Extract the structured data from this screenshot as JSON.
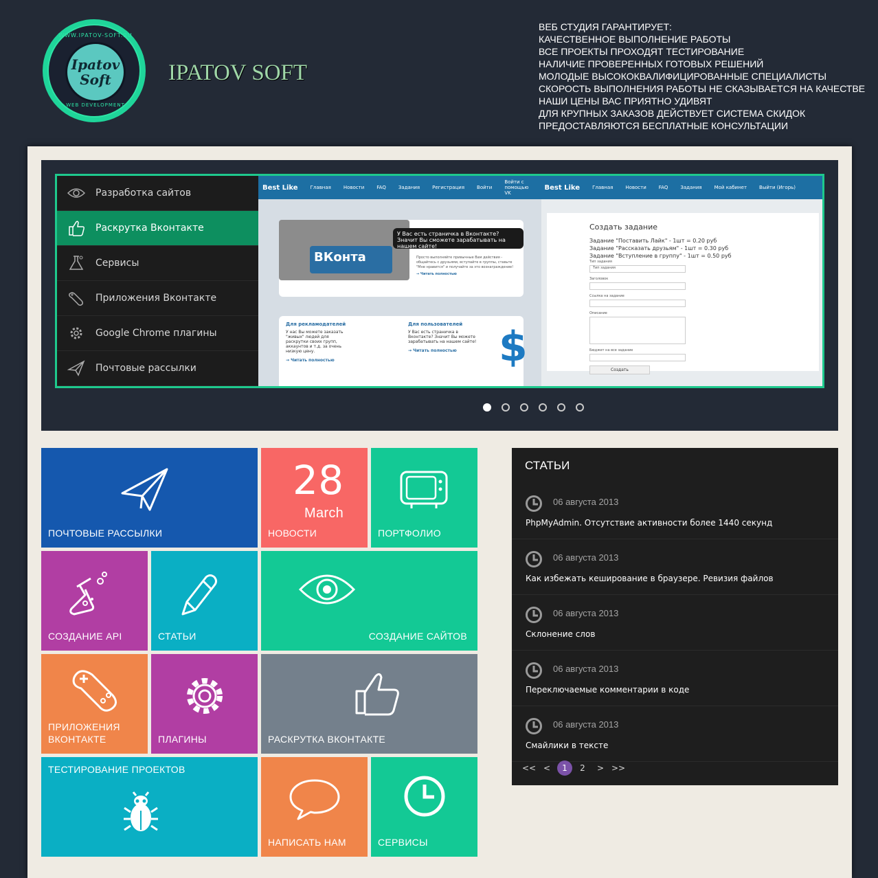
{
  "brand": {
    "name": "IPATOV SOFT",
    "logo_url_text": "WWW.IPATOV-SOFT.RU",
    "logo_name_line1": "Ipatov",
    "logo_name_line2": "Soft",
    "logo_bottom_text": "WEB DEVELOPMENT"
  },
  "guarantees": [
    "ВЕБ СТУДИЯ ГАРАНТИРУЕТ:",
    "КАЧЕСТВЕННОЕ ВЫПОЛНЕНИЕ РАБОТЫ",
    "ВСЕ ПРОЕКТЫ ПРОХОДЯТ ТЕСТИРОВАНИЕ",
    "НАЛИЧИЕ ПРОВЕРЕННЫХ ГОТОВЫХ РЕШЕНИЙ",
    "МОЛОДЫЕ ВЫСОКОКВАЛИФИЦИРОВАННЫЕ СПЕЦИАЛИСТЫ",
    "СКОРОСТЬ ВЫПОЛНЕНИЯ РАБОТЫ НЕ СКАЗЫВАЕТСЯ НА КАЧЕСТВЕ",
    "НАШИ ЦЕНЫ ВАС ПРИЯТНО УДИВЯТ",
    "ДЛЯ КРУПНЫХ ЗАКАЗОВ ДЕЙСТВУЕТ СИСТЕМА СКИДОК",
    "ПРЕДОСТАВЛЯЮТСЯ БЕСПЛАТНЫЕ КОНСУЛЬТАЦИИ"
  ],
  "slider": {
    "menu": [
      {
        "label": "Разработка сайтов",
        "icon": "eye-icon"
      },
      {
        "label": "Раскрутка Вконтакте",
        "icon": "thumbs-up-icon"
      },
      {
        "label": "Сервисы",
        "icon": "flask-icon"
      },
      {
        "label": "Приложения Вконтакте",
        "icon": "gamepad-icon"
      },
      {
        "label": "Google Chrome плагины",
        "icon": "gear-icon"
      },
      {
        "label": "Почтовые рассылки",
        "icon": "paper-plane-icon"
      }
    ],
    "active_index": 1,
    "slide": {
      "nav_left": [
        "Best Like",
        "Главная",
        "Новости",
        "FAQ",
        "Задания",
        "Регистрация",
        "Войти",
        "Войти с помощью VK"
      ],
      "nav_right": [
        "Best Like",
        "Главная",
        "Новости",
        "FAQ",
        "Задания",
        "Мой кабинет",
        "Выйти (Игорь)"
      ],
      "browser_text": "ВКонта",
      "bubble": "У Вас есть страничка в Вконтакте? Значит Вы сможете зарабатывать на нашем сайте!",
      "card_text": "Просто выполняйте привычные Вам действия - общайтесь с друзьями, вступайте в группы, ставьте \"Мне нравится\" и получайте за это вознаграждение!",
      "read_more": "→ Читать полностью",
      "adv_title": "Для рекламодателей",
      "adv_text": "У нас Вы можете заказать \"живых\" людей для раскрутки своих групп, аккаунтов и т.д. за очень низкую цену.",
      "user_title": "Для пользователей",
      "user_text": "У Вас есть страничка в Вконтакте? Значит Вы можете зарабатывать на нашем сайте!",
      "form_title": "Создать задание",
      "form_lines": [
        "Задание \"Поставить Лайк\" - 1шт = 0.20 руб",
        "Задание \"Рассказать друзьям\" - 1шт = 0.30 руб",
        "Задание \"Вступление в группу\" - 1шт = 0.50 руб"
      ],
      "form_labels": [
        "Тип задания",
        "Заголовок",
        "Ссылка на задание",
        "Описание",
        "Бюджет на все задание"
      ],
      "form_select": "Тип задания",
      "form_button": "Создать"
    },
    "dots_count": 6,
    "active_dot": 0
  },
  "tiles": {
    "mail": {
      "label": "ПОЧТОВЫЕ РАССЫЛКИ",
      "color": "#1558ae",
      "icon": "paper-plane-icon"
    },
    "news": {
      "label": "НОВОСТИ",
      "day": "28",
      "month": "March",
      "color": "#f86765"
    },
    "portfolio": {
      "label": "ПОРТФОЛИО",
      "color": "#13c995",
      "icon": "tv-icon"
    },
    "api": {
      "label": "СОЗДАНИЕ API",
      "color": "#b13ea3",
      "icon": "flask-icon"
    },
    "articles": {
      "label": "СТАТЬИ",
      "color": "#0aafc4",
      "icon": "pencil-icon"
    },
    "sites": {
      "label": "СОЗДАНИЕ САЙТОВ",
      "color": "#13c995",
      "icon": "eye-icon"
    },
    "apps": {
      "label": "ПРИЛОЖЕНИЯ ВКОНТАКТЕ",
      "color": "#f0854a",
      "icon": "gamepad-icon"
    },
    "plugins": {
      "label": "ПЛАГИНЫ",
      "color": "#b13ea3",
      "icon": "gear-icon"
    },
    "vk": {
      "label": "РАСКРУТКА ВКОНТАКТЕ",
      "color": "#74808c",
      "icon": "thumbs-up-icon"
    },
    "testing": {
      "label": "ТЕСТИРОВАНИЕ ПРОЕКТОВ",
      "color": "#0aafc4",
      "icon": "bug-icon"
    },
    "contact": {
      "label": "НАПИСАТЬ НАМ",
      "color": "#f0854a",
      "icon": "chat-bubble-icon"
    },
    "services": {
      "label": "СЕРВИСЫ",
      "color": "#13c995",
      "icon": "clock-icon"
    }
  },
  "articles": {
    "title": "СТАТЬИ",
    "items": [
      {
        "date": "06 августа 2013",
        "title": "PhpMyAdmin. Отсутствие активности более 1440 секунд"
      },
      {
        "date": "06 августа 2013",
        "title": "Как избежать кеширование в браузере. Ревизия файлов"
      },
      {
        "date": "06 августа 2013",
        "title": "Склонение слов"
      },
      {
        "date": "06 августа 2013",
        "title": "Переключаемые комментарии в коде"
      },
      {
        "date": "06 августа 2013",
        "title": "Смайлики в тексте"
      }
    ],
    "pager": {
      "first": "<<",
      "prev": "<",
      "page1": "1",
      "page2": "2",
      "next": ">",
      "last": ">>"
    }
  }
}
